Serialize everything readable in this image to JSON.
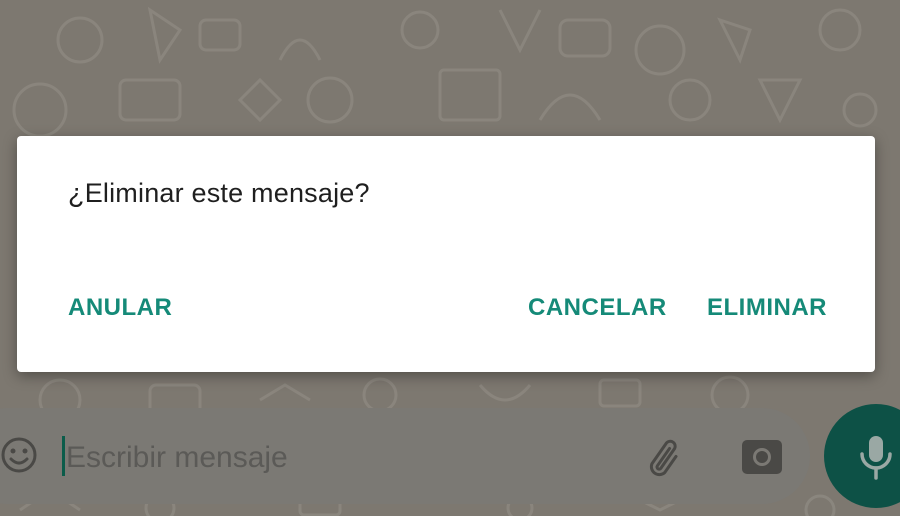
{
  "dialog": {
    "title": "¿Eliminar este mensaje?",
    "buttons": {
      "anular": "ANULAR",
      "cancelar": "CANCELAR",
      "eliminar": "ELIMINAR"
    },
    "accent_color": "#158a78"
  },
  "input_bar": {
    "placeholder": "Escribir mensaje",
    "icons": {
      "emoji": "emoji-icon",
      "attach": "paperclip-icon",
      "camera": "camera-icon",
      "mic": "microphone-icon"
    }
  }
}
